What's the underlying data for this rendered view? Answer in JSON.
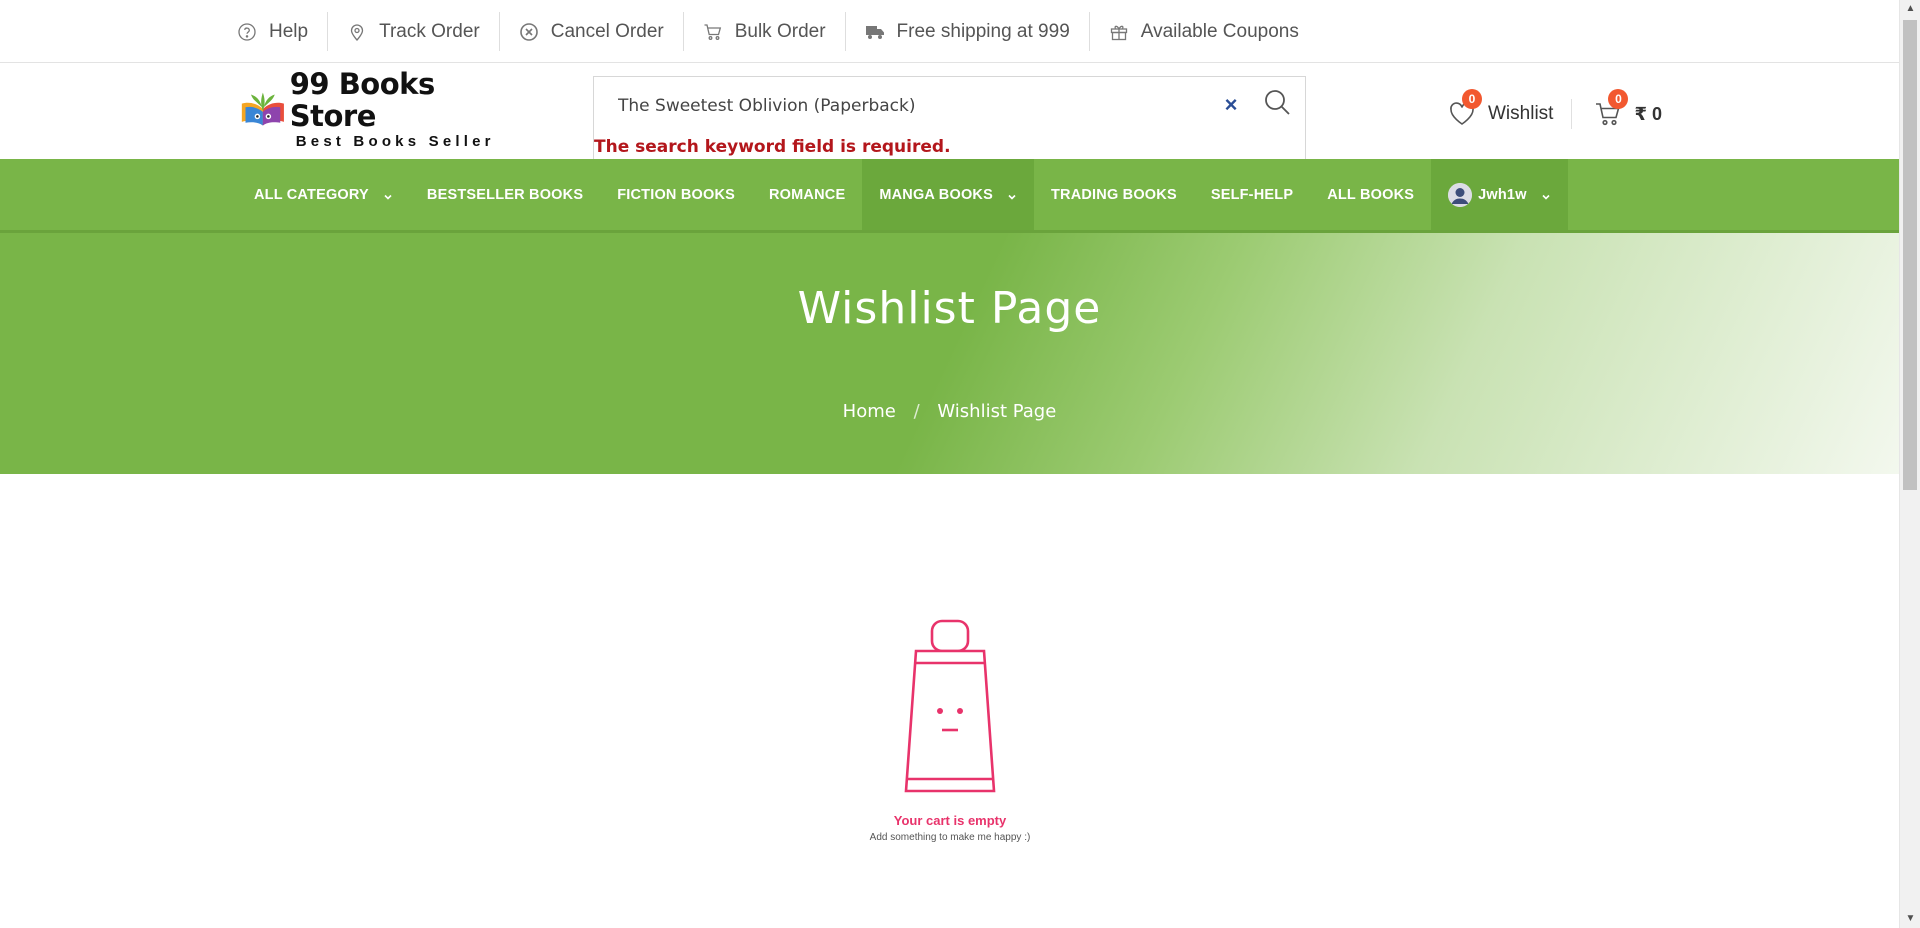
{
  "topbar": {
    "items": [
      {
        "label": "Help",
        "icon": "help-icon"
      },
      {
        "label": "Track Order",
        "icon": "location-pin-icon"
      },
      {
        "label": "Cancel Order",
        "icon": "cancel-circle-icon"
      },
      {
        "label": "Bulk Order",
        "icon": "cart-icon"
      },
      {
        "label": "Free shipping at 999",
        "icon": "truck-icon"
      },
      {
        "label": "Available Coupons",
        "icon": "gift-icon"
      }
    ]
  },
  "header": {
    "logo_title": "99 Books Store",
    "logo_subtitle": "Best Books Seller",
    "search": {
      "value": "The Sweetest Oblivion (Paperback)",
      "clear_symbol": "×",
      "error": "The search keyword field is required."
    },
    "wishlist": {
      "label": "Wishlist",
      "count": "0"
    },
    "cart": {
      "count": "0",
      "amount": "₹ 0"
    }
  },
  "nav": {
    "items": [
      {
        "label": "ALL CATEGORY",
        "dropdown": true
      },
      {
        "label": "BESTSELLER BOOKS"
      },
      {
        "label": "FICTION BOOKS"
      },
      {
        "label": "ROMANCE"
      },
      {
        "label": "MANGA BOOKS",
        "dropdown": true
      },
      {
        "label": "TRADING BOOKS"
      },
      {
        "label": "SELF-HELP"
      },
      {
        "label": "ALL BOOKS"
      }
    ],
    "user": {
      "name": "Jwh1w"
    }
  },
  "hero": {
    "title": "Wishlist Page",
    "breadcrumb": {
      "home": "Home",
      "separator": "/",
      "current": "Wishlist Page"
    }
  },
  "empty_state": {
    "title": "Your cart is empty",
    "subtitle": "Add something to make me happy :)"
  },
  "colors": {
    "brand_green": "#79b548",
    "badge": "#f2582f",
    "error": "#b3161b",
    "empty_pink": "#e8336b"
  }
}
